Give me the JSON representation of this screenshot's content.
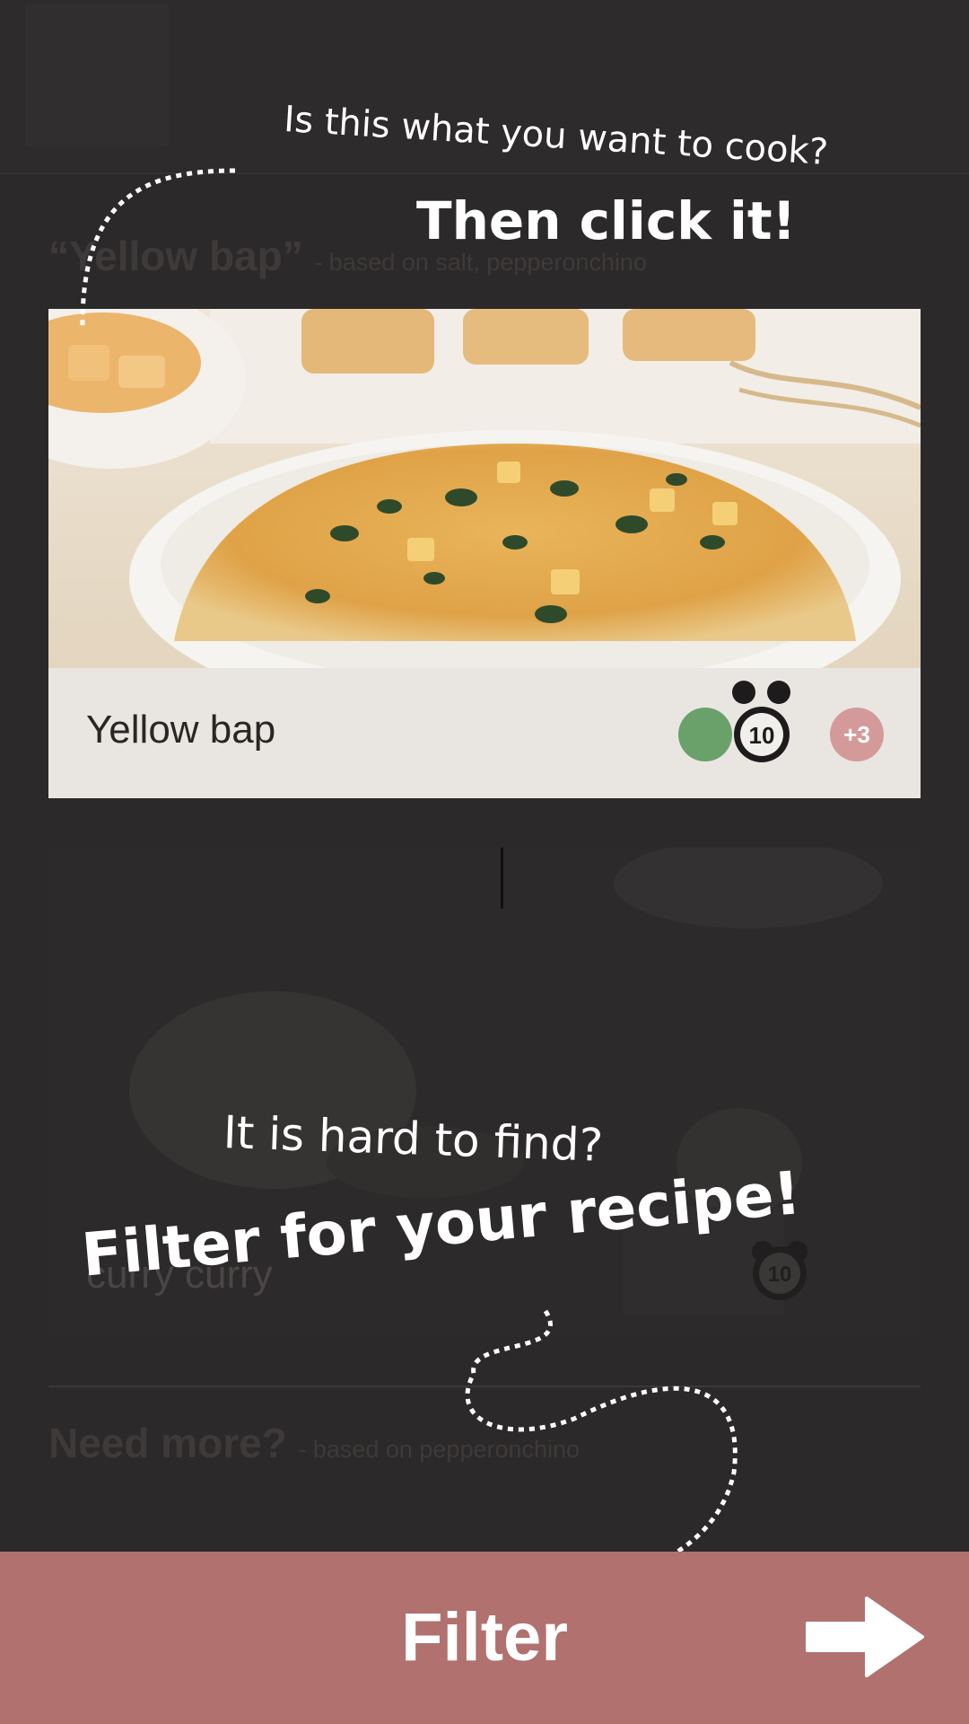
{
  "sections": {
    "first": {
      "title": "“Yellow bap”",
      "subtitle": "- based on salt, pepperonchino"
    },
    "second": {
      "title": "Need more?",
      "subtitle": "- based on pepperonchino"
    }
  },
  "main_card": {
    "title": "Yellow bap",
    "timer_minutes": "10",
    "extra_count": "+3",
    "photo_icon": "rice-bowl-photo"
  },
  "second_card": {
    "title": "curry curry",
    "timer_minutes": "10"
  },
  "hints": {
    "question_top": "Is this what you want to cook?",
    "cta_top": "Then click it!",
    "question_bottom": "It is hard to find?",
    "cta_bottom": "Filter for your recipe!"
  },
  "filter_bar": {
    "label": "Filter",
    "arrow_icon": "arrow-right-icon"
  },
  "colors": {
    "overlay": "#2b2929",
    "filter_bar": "#b1716f",
    "badge_green": "#6aa16a",
    "badge_more": "#d49a9a"
  }
}
